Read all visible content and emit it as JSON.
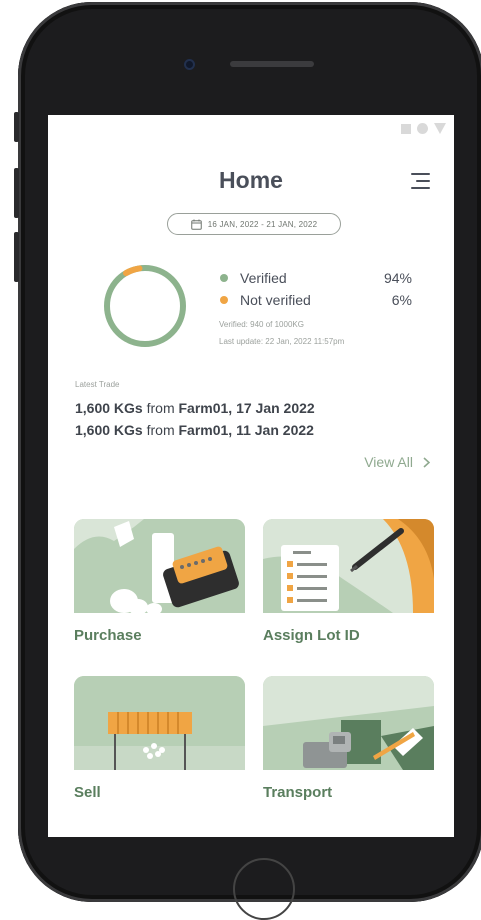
{
  "header": {
    "title": "Home"
  },
  "date_range": "16 JAN, 2022 - 21 JAN, 2022",
  "verification": {
    "verified_pct": 94,
    "items": [
      {
        "label": "Verified",
        "value": "94%",
        "color": "#8db38d"
      },
      {
        "label": "Not verified",
        "value": "6%",
        "color": "#f0a544"
      }
    ],
    "verified_text": "Verified: 940 of 1000KG",
    "last_update": "Last update: 22 Jan, 2022 11:57pm"
  },
  "latest_trade": {
    "label": "Latest Trade",
    "items": [
      {
        "qty": "1,600 KGs",
        "from": " from ",
        "farm": "Farm01, 17 Jan 2022"
      },
      {
        "qty": "1,600 KGs",
        "from": " from ",
        "farm": "Farm01, 11 Jan 2022"
      }
    ],
    "view_all": "View All"
  },
  "actions": [
    {
      "label": "Purchase"
    },
    {
      "label": "Assign Lot ID"
    },
    {
      "label": "Sell"
    },
    {
      "label": "Transport"
    }
  ],
  "colors": {
    "accent_green": "#5a7e5e",
    "orange": "#f0a544",
    "bg_green": "#b7cfb5"
  }
}
